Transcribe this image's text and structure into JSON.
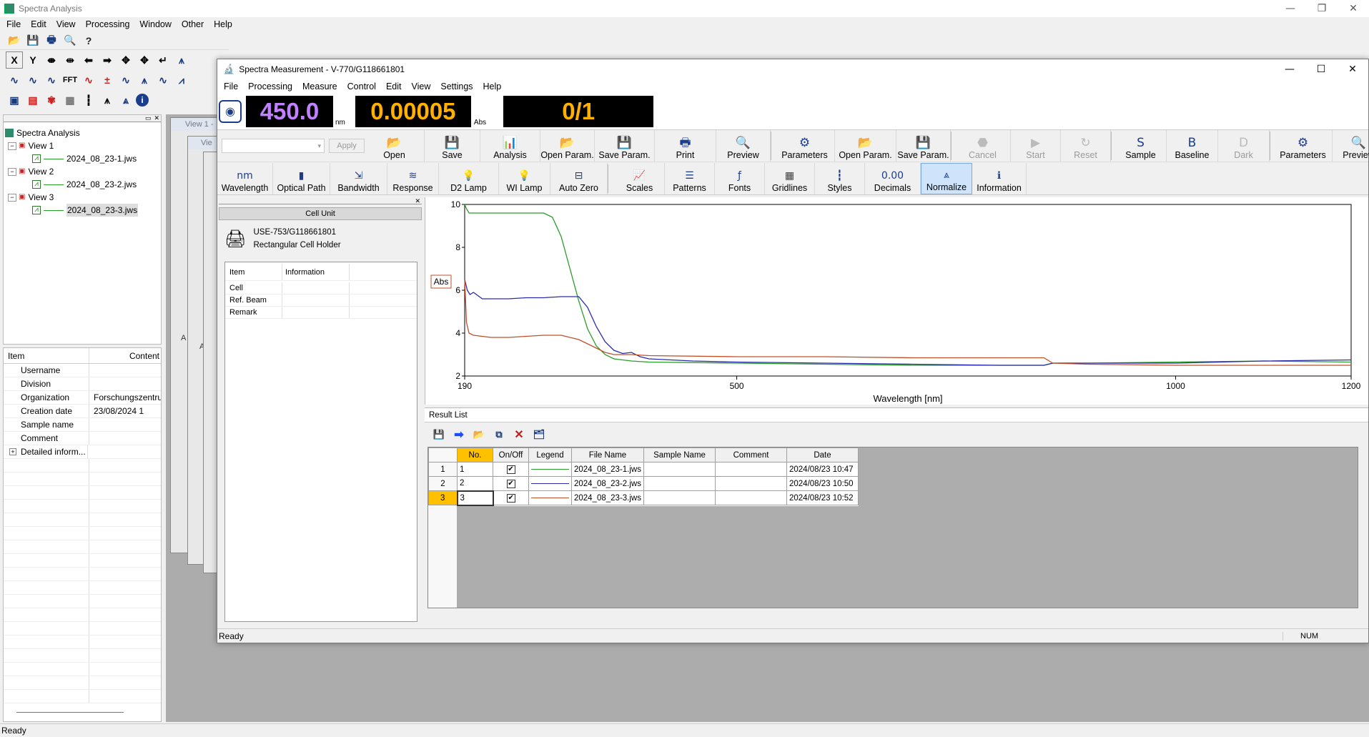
{
  "app": {
    "title": "Spectra Analysis",
    "menu": [
      "File",
      "Edit",
      "View",
      "Processing",
      "Window",
      "Other",
      "Help"
    ],
    "status": "Ready"
  },
  "left_panel": {
    "tree": {
      "root": "Spectra Analysis",
      "views": [
        {
          "label": "View 1",
          "file": "2024_08_23-1.jws"
        },
        {
          "label": "View 2",
          "file": "2024_08_23-2.jws"
        },
        {
          "label": "View 3",
          "file": "2024_08_23-3.jws"
        }
      ]
    },
    "props": {
      "header_item": "Item",
      "header_content": "Content",
      "rows": [
        {
          "item": "Username",
          "content": ""
        },
        {
          "item": "Division",
          "content": ""
        },
        {
          "item": "Organization",
          "content": "Forschungszentru"
        },
        {
          "item": "Creation date",
          "content": "23/08/2024 1"
        },
        {
          "item": "Sample name",
          "content": ""
        },
        {
          "item": "Comment",
          "content": ""
        },
        {
          "item": "Detailed inform...",
          "content": ""
        }
      ]
    },
    "bg_windows": [
      "View 1 -",
      "Vie",
      "A",
      "A"
    ]
  },
  "toolbar_text": {
    "fft": "FFT",
    "x": "X",
    "y": "Y"
  },
  "measure": {
    "title": "Spectra Measurement - V-770/G118661801",
    "menu": [
      "File",
      "Processing",
      "Measure",
      "Control",
      "Edit",
      "View",
      "Settings",
      "Help"
    ],
    "wavelength": "450.0",
    "wavelength_unit": "nm",
    "absorbance": "0.00005",
    "abs_unit": "Abs",
    "count": "0/1",
    "apply_label": "Apply",
    "toolbar1": [
      {
        "label": "Open",
        "icon": "open-icon",
        "glyph": "📂"
      },
      {
        "label": "Save",
        "icon": "save-icon",
        "glyph": "💾"
      },
      {
        "label": "Analysis",
        "icon": "analysis-icon",
        "glyph": "📊"
      },
      {
        "label": "Open Param.",
        "icon": "open-param-icon",
        "glyph": "📂"
      },
      {
        "label": "Save Param.",
        "icon": "save-param-icon",
        "glyph": "💾"
      },
      {
        "label": "Print",
        "icon": "print-icon",
        "glyph": "🖶"
      },
      {
        "label": "Preview",
        "icon": "preview-icon",
        "glyph": "🔍"
      },
      {
        "label": "Parameters",
        "icon": "parameters-icon",
        "glyph": "⚙"
      },
      {
        "label": "Open Param.",
        "icon": "open-param-icon",
        "glyph": "📂"
      },
      {
        "label": "Save Param.",
        "icon": "save-param-icon",
        "glyph": "💾"
      },
      {
        "label": "Cancel",
        "icon": "stop-icon",
        "glyph": "⬣",
        "disabled": true
      },
      {
        "label": "Start",
        "icon": "start-icon",
        "glyph": "▶",
        "disabled": true
      },
      {
        "label": "Reset",
        "icon": "reset-icon",
        "glyph": "↻",
        "disabled": true
      },
      {
        "label": "Sample",
        "icon": "sample-icon",
        "glyph": "S"
      },
      {
        "label": "Baseline",
        "icon": "baseline-icon",
        "glyph": "B"
      },
      {
        "label": "Dark",
        "icon": "dark-icon",
        "glyph": "D",
        "disabled": true
      },
      {
        "label": "Parameters",
        "icon": "parameters-icon",
        "glyph": "⚙"
      },
      {
        "label": "Preview",
        "icon": "preview-icon",
        "glyph": "🔍"
      }
    ],
    "toolbar2": [
      {
        "label": "Wavelength",
        "icon": "wavelength-icon",
        "glyph": "nm"
      },
      {
        "label": "Optical Path",
        "icon": "optical-path-icon",
        "glyph": "▮"
      },
      {
        "label": "Bandwidth",
        "icon": "bandwidth-icon",
        "glyph": "⇲"
      },
      {
        "label": "Response",
        "icon": "response-icon",
        "glyph": "≋"
      },
      {
        "label": "D2 Lamp",
        "icon": "d2-lamp-icon",
        "glyph": "💡"
      },
      {
        "label": "WI Lamp",
        "icon": "wi-lamp-icon",
        "glyph": "💡"
      },
      {
        "label": "Auto Zero",
        "icon": "auto-zero-icon",
        "glyph": "⊟"
      },
      {
        "label": "Scales",
        "icon": "scales-icon",
        "glyph": "📈"
      },
      {
        "label": "Patterns",
        "icon": "patterns-icon",
        "glyph": "☰"
      },
      {
        "label": "Fonts",
        "icon": "fonts-icon",
        "glyph": "ƒ"
      },
      {
        "label": "Gridlines",
        "icon": "gridlines-icon",
        "glyph": "▦"
      },
      {
        "label": "Styles",
        "icon": "styles-icon",
        "glyph": "┇"
      },
      {
        "label": "Decimals",
        "icon": "decimals-icon",
        "glyph": "0.00"
      },
      {
        "label": "Normalize",
        "icon": "normalize-icon",
        "glyph": "⩓",
        "active": true
      },
      {
        "label": "Information",
        "icon": "information-icon",
        "glyph": "ℹ"
      }
    ],
    "cell_unit": {
      "header": "Cell Unit",
      "model": "USE-753/G118661801",
      "holder": "Rectangular Cell Holder",
      "col_item": "Item",
      "col_info": "Information",
      "rows": [
        "Cell",
        "Ref. Beam",
        "Remark"
      ]
    },
    "status": "Ready",
    "status_num": "NUM",
    "result_list": {
      "tab": "Result List",
      "headers": [
        "No.",
        "On/Off",
        "Legend",
        "File Name",
        "Sample Name",
        "Comment",
        "Date"
      ],
      "rows": [
        {
          "idx": "1",
          "no": "1",
          "file": "2024_08_23-1.jws",
          "sample": "",
          "comment": "",
          "date": "2024/08/23 10:47",
          "color": "#2a9d2a"
        },
        {
          "idx": "2",
          "no": "2",
          "file": "2024_08_23-2.jws",
          "sample": "",
          "comment": "",
          "date": "2024/08/23 10:50",
          "color": "#2b2bb0"
        },
        {
          "idx": "3",
          "no": "3",
          "file": "2024_08_23-3.jws",
          "sample": "",
          "comment": "",
          "date": "2024/08/23 10:52",
          "color": "#c0502a"
        }
      ]
    }
  },
  "chart_data": {
    "type": "line",
    "xlabel": "Wavelength [nm]",
    "ylabel": "Abs",
    "xlim": [
      190,
      1200
    ],
    "ylim": [
      2,
      10
    ],
    "x_ticks": [
      190,
      500,
      1000,
      1200
    ],
    "y_ticks": [
      2,
      4,
      6,
      8,
      10
    ],
    "series": [
      {
        "color": "#2a9d2a",
        "x": [
          190,
          192,
          195,
          200,
          220,
          250,
          280,
          290,
          300,
          310,
          320,
          330,
          340,
          350,
          360,
          380,
          400,
          500,
          600,
          700,
          800,
          850,
          860,
          900,
          1000,
          1100,
          1200
        ],
        "y": [
          10,
          9.8,
          9.6,
          9.6,
          9.6,
          9.6,
          9.6,
          9.4,
          8.5,
          7.0,
          5.5,
          4.2,
          3.4,
          3.0,
          2.8,
          2.7,
          2.65,
          2.6,
          2.55,
          2.5,
          2.5,
          2.5,
          2.6,
          2.6,
          2.65,
          2.7,
          2.65
        ]
      },
      {
        "color": "#2b2bb0",
        "x": [
          190,
          193,
          196,
          200,
          210,
          220,
          240,
          260,
          280,
          300,
          320,
          330,
          340,
          350,
          360,
          370,
          380,
          390,
          400,
          450,
          500,
          600,
          700,
          800,
          850,
          860,
          900,
          1000,
          1100,
          1200
        ],
        "y": [
          6.5,
          6.0,
          5.8,
          5.9,
          5.6,
          5.6,
          5.6,
          5.65,
          5.65,
          5.7,
          5.7,
          5.2,
          4.3,
          3.6,
          3.2,
          3.05,
          3.1,
          2.9,
          2.8,
          2.7,
          2.65,
          2.6,
          2.55,
          2.5,
          2.5,
          2.6,
          2.6,
          2.6,
          2.7,
          2.75
        ]
      },
      {
        "color": "#c0502a",
        "x": [
          190,
          192,
          195,
          200,
          220,
          240,
          260,
          280,
          300,
          320,
          330,
          340,
          350,
          360,
          380,
          400,
          500,
          600,
          700,
          800,
          850,
          860,
          900,
          1000,
          1100,
          1200
        ],
        "y": [
          6.5,
          4.5,
          4.0,
          3.9,
          3.8,
          3.8,
          3.85,
          3.9,
          3.9,
          3.7,
          3.5,
          3.3,
          3.1,
          3.0,
          3.0,
          2.95,
          2.9,
          2.9,
          2.85,
          2.85,
          2.85,
          2.6,
          2.55,
          2.5,
          2.5,
          2.5
        ]
      }
    ]
  }
}
